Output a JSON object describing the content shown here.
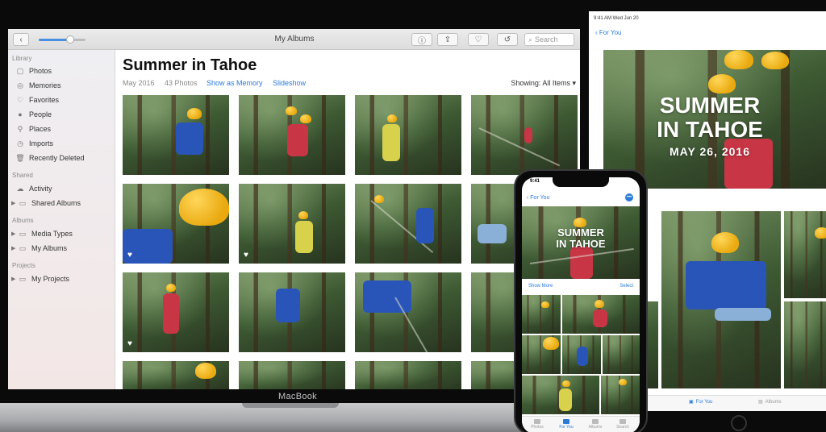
{
  "mac": {
    "window_title": "My Albums",
    "search_placeholder": "Search",
    "brand": "MacBook",
    "sidebar": {
      "sections": [
        {
          "header": "Library",
          "items": [
            {
              "label": "Photos",
              "icon": "photos-icon"
            },
            {
              "label": "Memories",
              "icon": "memories-icon"
            },
            {
              "label": "Favorites",
              "icon": "heart-icon"
            },
            {
              "label": "People",
              "icon": "person-icon"
            },
            {
              "label": "Places",
              "icon": "pin-icon"
            },
            {
              "label": "Imports",
              "icon": "clock-icon"
            },
            {
              "label": "Recently Deleted",
              "icon": "trash-icon"
            }
          ]
        },
        {
          "header": "Shared",
          "items": [
            {
              "label": "Activity",
              "icon": "cloud-icon"
            },
            {
              "label": "Shared Albums",
              "icon": "folder-icon"
            }
          ]
        },
        {
          "header": "Albums",
          "items": [
            {
              "label": "Media Types",
              "icon": "folder-icon"
            },
            {
              "label": "My Albums",
              "icon": "folder-icon"
            }
          ]
        },
        {
          "header": "Projects",
          "items": [
            {
              "label": "My Projects",
              "icon": "folder-icon"
            }
          ]
        }
      ]
    },
    "album": {
      "title": "Summer in Tahoe",
      "date": "May 2016",
      "count": "43 Photos",
      "show_as_memory": "Show as Memory",
      "slideshow": "Slideshow",
      "showing": "Showing: All Items",
      "favorites_in_grid": 3
    }
  },
  "ipad": {
    "status": "9:41 AM Wed Jun 20",
    "back_label": "For You",
    "hero_line1": "SUMMER",
    "hero_line2": "IN TAHOE",
    "hero_date": "MAY 26, 2016",
    "tabs": [
      "For You",
      "Albums"
    ],
    "active_tab": "For You"
  },
  "iphone": {
    "time": "9:41",
    "back_label": "For You",
    "hero_line1": "SUMMER",
    "hero_line2": "IN TAHOE",
    "show_more": "Show More",
    "select": "Select",
    "tabs": [
      "Photos",
      "For You",
      "Albums",
      "Search"
    ],
    "active_tab": "For You"
  },
  "colors": {
    "accent": "#2c7bd8",
    "helmet": "#f2b91c",
    "forest": "#3d5a33"
  }
}
